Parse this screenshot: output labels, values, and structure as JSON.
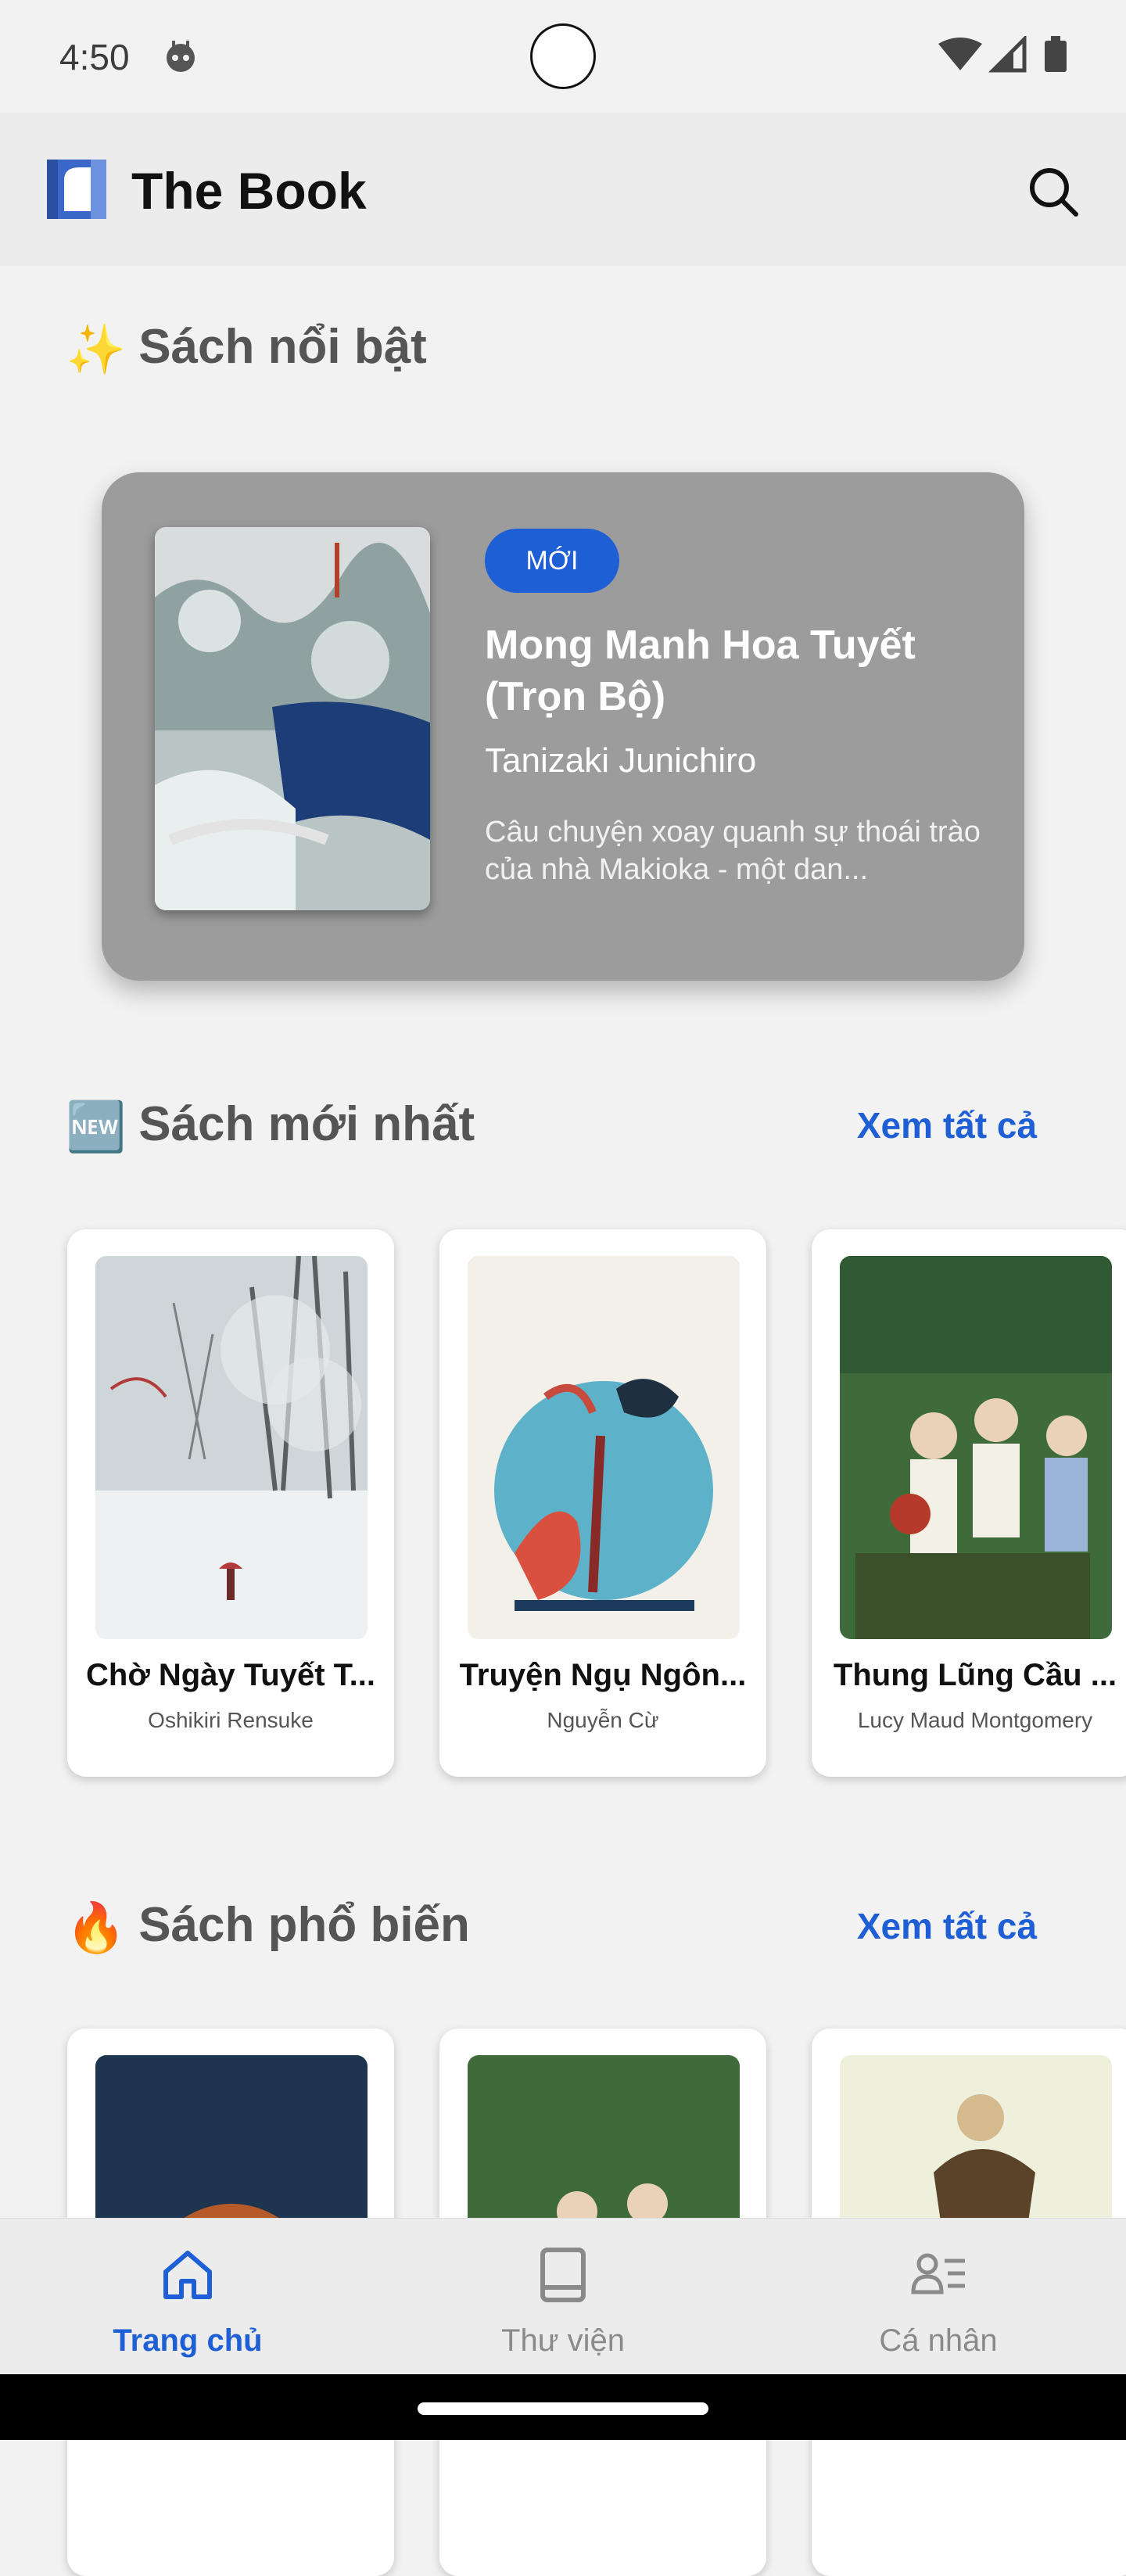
{
  "status_bar": {
    "time": "4:50"
  },
  "app": {
    "title": "The Book"
  },
  "featured_section": {
    "emoji": "✨",
    "title": "Sách nổi bật",
    "book": {
      "badge": "MỚI",
      "title": "Mong Manh Hoa Tuyết (Trọn Bộ)",
      "author": "Tanizaki Junichiro",
      "description": "Câu chuyện xoay quanh sự thoái trào của nhà Makioka - một dan..."
    }
  },
  "newest_section": {
    "emoji": "🆕",
    "title": "Sách mới nhất",
    "see_all": "Xem tất cả",
    "books": [
      {
        "title": "Chờ Ngày Tuyết T...",
        "author": "Oshikiri Rensuke"
      },
      {
        "title": "Truyện Ngụ Ngôn...",
        "author": "Nguyễn Cừ"
      },
      {
        "title": "Thung Lũng Cầu ...",
        "author": "Lucy Maud Montgomery"
      }
    ]
  },
  "popular_section": {
    "emoji": "🔥",
    "title": "Sách phổ biến",
    "see_all": "Xem tất cả"
  },
  "bottom_nav": {
    "items": [
      {
        "label": "Trang chủ",
        "icon": "home-icon",
        "active": true
      },
      {
        "label": "Thư viện",
        "icon": "book-icon",
        "active": false
      },
      {
        "label": "Cá nhân",
        "icon": "profile-list-icon",
        "active": false
      }
    ]
  },
  "colors": {
    "accent": "#1f5fd6",
    "featured_bg": "#9c9c9c",
    "background": "#f2f2f2"
  }
}
